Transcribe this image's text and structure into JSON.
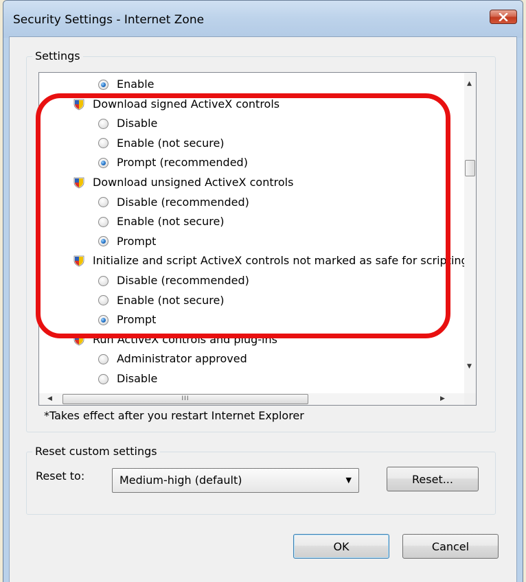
{
  "window": {
    "title": "Security Settings - Internet Zone"
  },
  "settings": {
    "group_label": "Settings",
    "rows": [
      {
        "kind": "option",
        "label": "Enable",
        "checked": true
      },
      {
        "kind": "category",
        "label": "Download signed ActiveX controls"
      },
      {
        "kind": "option",
        "label": "Disable",
        "checked": false
      },
      {
        "kind": "option",
        "label": "Enable (not secure)",
        "checked": false
      },
      {
        "kind": "option",
        "label": "Prompt (recommended)",
        "checked": true
      },
      {
        "kind": "category",
        "label": "Download unsigned ActiveX controls"
      },
      {
        "kind": "option",
        "label": "Disable (recommended)",
        "checked": false
      },
      {
        "kind": "option",
        "label": "Enable (not secure)",
        "checked": false
      },
      {
        "kind": "option",
        "label": "Prompt",
        "checked": true
      },
      {
        "kind": "category",
        "label": "Initialize and script ActiveX controls not marked as safe for scripting"
      },
      {
        "kind": "option",
        "label": "Disable (recommended)",
        "checked": false
      },
      {
        "kind": "option",
        "label": "Enable (not secure)",
        "checked": false
      },
      {
        "kind": "option",
        "label": "Prompt",
        "checked": true
      },
      {
        "kind": "category",
        "label": "Run ActiveX controls and plug-ins"
      },
      {
        "kind": "option",
        "label": "Administrator approved",
        "checked": false
      },
      {
        "kind": "option",
        "label": "Disable",
        "checked": false
      }
    ],
    "note": "*Takes effect after you restart Internet Explorer",
    "hscroll_grip": "III"
  },
  "reset": {
    "group_label": "Reset custom settings",
    "reset_to_label": "Reset to:",
    "selected": "Medium-high (default)",
    "reset_button": "Reset..."
  },
  "footer": {
    "ok_label": "OK",
    "cancel_label": "Cancel"
  },
  "colors": {
    "highlight": "#e81010",
    "shield_yellow": "#f3c200",
    "shield_blue": "#2f5fb8",
    "shield_red": "#d8322a"
  }
}
